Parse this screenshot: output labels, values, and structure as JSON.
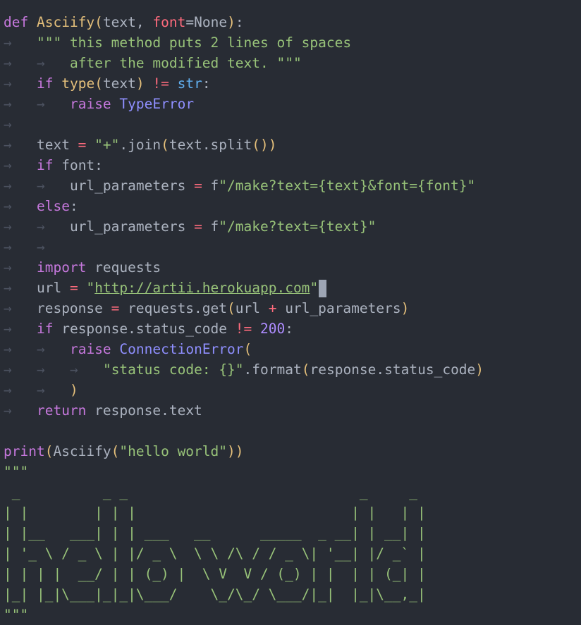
{
  "editor": {
    "language": "python",
    "colors": {
      "background": "#282c34",
      "keyword": "#c678dd",
      "function": "#e5c07b",
      "string": "#98c379",
      "builtin": "#61afef",
      "number": "#ae8cff"
    },
    "lines": [
      "def Asciify(text, font=None):",
      "→   \"\"\" this method puts 2 lines of spaces",
      "→   →   after the modified text. \"\"\"",
      "→   if type(text) != str:",
      "→   →   raise TypeError",
      "→",
      "→   text = \"+\".join(text.split())",
      "→   if font:",
      "→   →   url_parameters = f\"/make?text={text}&font={font}\"",
      "→   else:",
      "→   →   url_parameters = f\"/make?text={text}\"",
      "→   →",
      "→   import requests",
      "→   url = \"http://artii.herokuapp.com\"",
      "→   response = requests.get(url + url_parameters)",
      "→   if response.status_code != 200:",
      "→   →   raise ConnectionError(",
      "→   →   →   \"status code: {}\".format(response.status_code)",
      "→   →   )",
      "→   return response.text",
      "",
      "print(Asciify(\"hello world\"))",
      "\"\"\"",
      " _          _ _                            _     _ ",
      "| |        | | |                          | |   | |",
      "| |__   ___| | | ___   __      _____  _ __| | __| |",
      "| '_ \\ / _ \\ | |/ _ \\  \\ \\ /\\ / / _ \\| '__| |/ _` |",
      "| | | |  __/ | | (_) |  \\ V  V / (_) | |  | | (_| |",
      "|_| |_|\\___|_|_|\\___/    \\_/\\_/ \\___/|_|  |_|\\__,_|",
      "\"\"\""
    ]
  }
}
